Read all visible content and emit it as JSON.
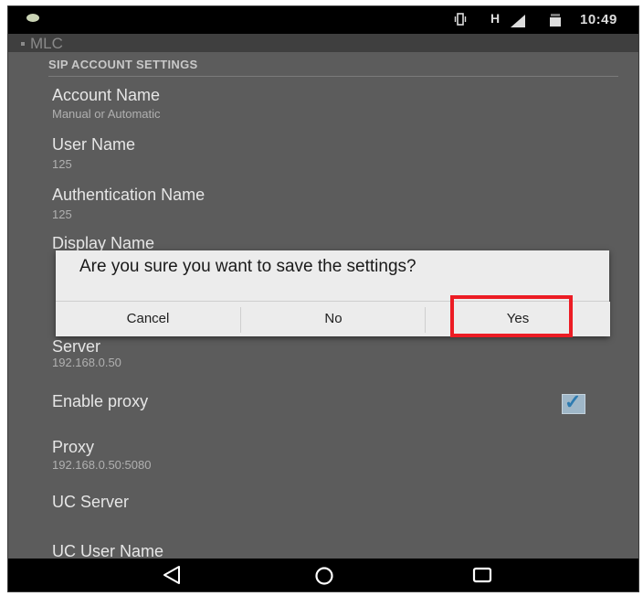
{
  "status_bar": {
    "network_type": "H",
    "time": "10:49",
    "icons": [
      "notification-dot-icon",
      "vibrate-icon",
      "signal-icon",
      "battery-icon"
    ]
  },
  "app": {
    "title": "MLC"
  },
  "settings": {
    "section_header": "SIP ACCOUNT SETTINGS",
    "items": [
      {
        "title": "Account Name",
        "summary": "Manual or Automatic"
      },
      {
        "title": "User Name",
        "summary": "125"
      },
      {
        "title": "Authentication Name",
        "summary": "125"
      },
      {
        "title": "Display Name",
        "summary": ""
      },
      {
        "title": "Server",
        "summary": "192.168.0.50"
      },
      {
        "title": "Enable proxy",
        "summary": "",
        "checked": true
      },
      {
        "title": "Proxy",
        "summary": "192.168.0.50:5080"
      },
      {
        "title": "UC Server",
        "summary": ""
      },
      {
        "title": "UC User Name",
        "summary": ""
      }
    ]
  },
  "dialog": {
    "message": "Are you sure you want to save the settings?",
    "buttons": {
      "cancel": "Cancel",
      "no": "No",
      "yes": "Yes"
    },
    "highlight_color": "#ec1c24"
  },
  "nav_bar": {
    "icons": [
      "back-icon",
      "home-icon",
      "recents-icon"
    ]
  }
}
